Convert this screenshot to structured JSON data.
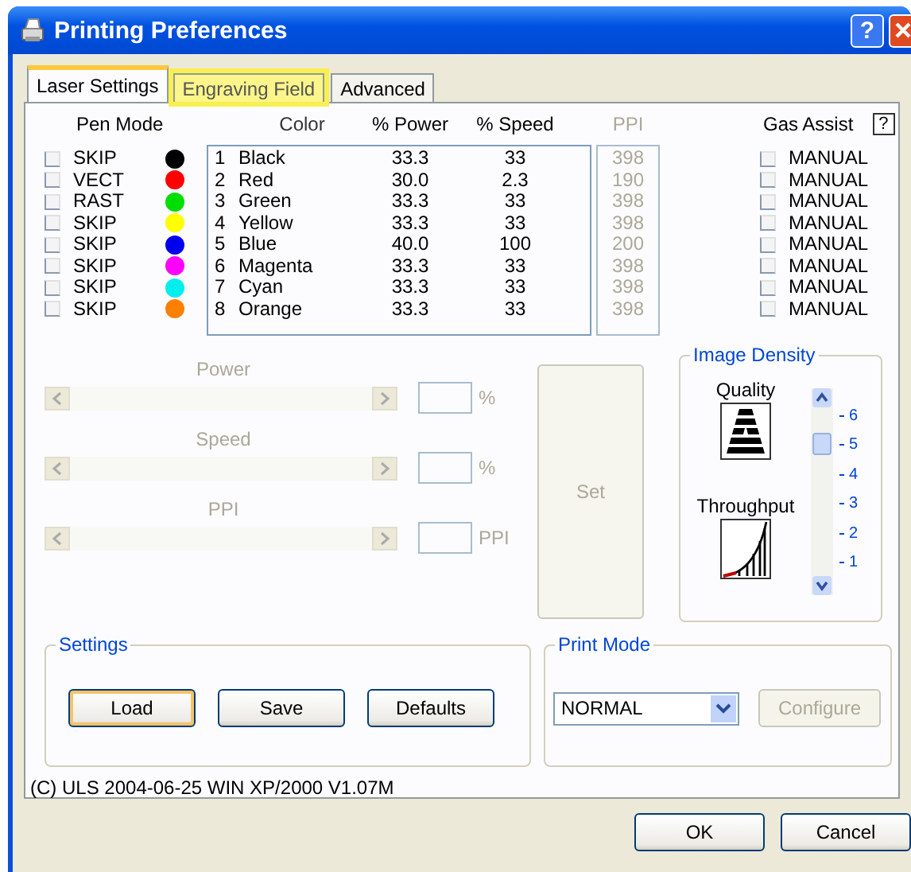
{
  "window": {
    "title": "Printing Preferences",
    "help_label": "?"
  },
  "tabs": [
    {
      "label": "Laser Settings",
      "selected": true,
      "highlighted": false
    },
    {
      "label": "Engraving Field",
      "selected": false,
      "highlighted": true
    },
    {
      "label": "Advanced",
      "selected": false,
      "highlighted": false
    }
  ],
  "pen_table": {
    "columns": {
      "pen_mode": "Pen Mode",
      "color_name": "Color",
      "power": "% Power",
      "speed": "% Speed",
      "ppi": "PPI",
      "gas_assist": "Gas Assist",
      "help": "?"
    },
    "ppi_disabled": true,
    "pens": [
      {
        "mode": "SKIP",
        "mode_checked": false,
        "color": "#000000",
        "number": "1",
        "name": "Black",
        "power": "33.3",
        "speed": "33",
        "ppi": "398",
        "gas": "MANUAL",
        "gas_checked": false
      },
      {
        "mode": "VECT",
        "mode_checked": false,
        "color": "#ff0000",
        "number": "2",
        "name": "Red",
        "power": "30.0",
        "speed": "2.3",
        "ppi": "190",
        "gas": "MANUAL",
        "gas_checked": false
      },
      {
        "mode": "RAST",
        "mode_checked": false,
        "color": "#00dd00",
        "number": "3",
        "name": "Green",
        "power": "33.3",
        "speed": "33",
        "ppi": "398",
        "gas": "MANUAL",
        "gas_checked": false
      },
      {
        "mode": "SKIP",
        "mode_checked": false,
        "color": "#ffff00",
        "number": "4",
        "name": "Yellow",
        "power": "33.3",
        "speed": "33",
        "ppi": "398",
        "gas": "MANUAL",
        "gas_checked": false
      },
      {
        "mode": "SKIP",
        "mode_checked": false,
        "color": "#0000ee",
        "number": "5",
        "name": "Blue",
        "power": "40.0",
        "speed": "100",
        "ppi": "200",
        "gas": "MANUAL",
        "gas_checked": false
      },
      {
        "mode": "SKIP",
        "mode_checked": false,
        "color": "#ff00ff",
        "number": "6",
        "name": "Magenta",
        "power": "33.3",
        "speed": "33",
        "ppi": "398",
        "gas": "MANUAL",
        "gas_checked": false
      },
      {
        "mode": "SKIP",
        "mode_checked": false,
        "color": "#00eeee",
        "number": "7",
        "name": "Cyan",
        "power": "33.3",
        "speed": "33",
        "ppi": "398",
        "gas": "MANUAL",
        "gas_checked": false
      },
      {
        "mode": "SKIP",
        "mode_checked": false,
        "color": "#ff7f00",
        "number": "8",
        "name": "Orange",
        "power": "33.3",
        "speed": "33",
        "ppi": "398",
        "gas": "MANUAL",
        "gas_checked": false
      }
    ]
  },
  "sliders": [
    {
      "label": "Power",
      "unit": "%",
      "disabled": true
    },
    {
      "label": "Speed",
      "unit": "%",
      "disabled": true
    },
    {
      "label": "PPI",
      "unit": "PPI",
      "disabled": true
    }
  ],
  "set_button": {
    "label": "Set",
    "disabled": true
  },
  "image_density": {
    "title": "Image Density",
    "quality_label": "Quality",
    "throughput_label": "Throughput",
    "scale": [
      "6",
      "5",
      "4",
      "3",
      "2",
      "1"
    ],
    "level": 0.78
  },
  "settings": {
    "title": "Settings",
    "buttons": [
      {
        "label": "Load",
        "focused": true
      },
      {
        "label": "Save",
        "focused": false
      },
      {
        "label": "Defaults",
        "focused": false
      }
    ]
  },
  "print_mode": {
    "title": "Print Mode",
    "value": "NORMAL",
    "configure": {
      "label": "Configure",
      "disabled": true
    }
  },
  "copyright": "(C) ULS 2004-06-25 WIN XP/2000 V1.07M",
  "dialog_buttons": [
    {
      "label": "OK"
    },
    {
      "label": "Cancel"
    }
  ]
}
